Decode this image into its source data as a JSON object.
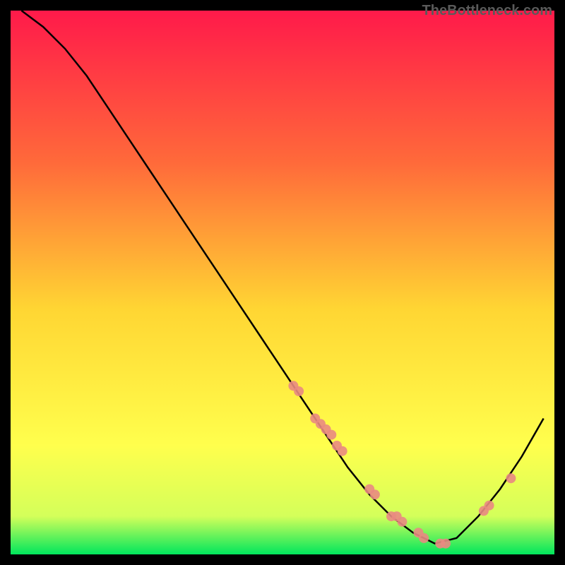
{
  "watermark": "TheBottleneck.com",
  "chart_data": {
    "type": "line",
    "title": "",
    "xlabel": "",
    "ylabel": "",
    "xlim": [
      0,
      100
    ],
    "ylim": [
      0,
      100
    ],
    "grid": false,
    "background_gradient": {
      "top": "#ff1a4a",
      "upper_mid": "#ff7a3a",
      "mid": "#ffd633",
      "lower_mid": "#ffff4d",
      "bottom": "#00ff66"
    },
    "series": [
      {
        "name": "bottleneck-curve",
        "type": "line",
        "color": "#000000",
        "x": [
          2,
          6,
          10,
          14,
          18,
          22,
          26,
          30,
          34,
          38,
          42,
          46,
          50,
          54,
          58,
          62,
          66,
          70,
          74,
          78,
          82,
          86,
          90,
          94,
          98
        ],
        "y": [
          100,
          97,
          93,
          88,
          82,
          76,
          70,
          64,
          58,
          52,
          46,
          40,
          34,
          28,
          22,
          16,
          11,
          7,
          4,
          2,
          3,
          7,
          12,
          18,
          25
        ]
      },
      {
        "name": "highlight-points",
        "type": "scatter",
        "color": "#e98a82",
        "x": [
          52,
          53,
          56,
          57,
          58,
          59,
          60,
          61,
          66,
          67,
          70,
          71,
          72,
          75,
          76,
          79,
          80,
          87,
          88,
          92
        ],
        "y": [
          31,
          30,
          25,
          24,
          23,
          22,
          20,
          19,
          12,
          11,
          7,
          7,
          6,
          4,
          3,
          2,
          2,
          8,
          9,
          14
        ]
      }
    ]
  }
}
